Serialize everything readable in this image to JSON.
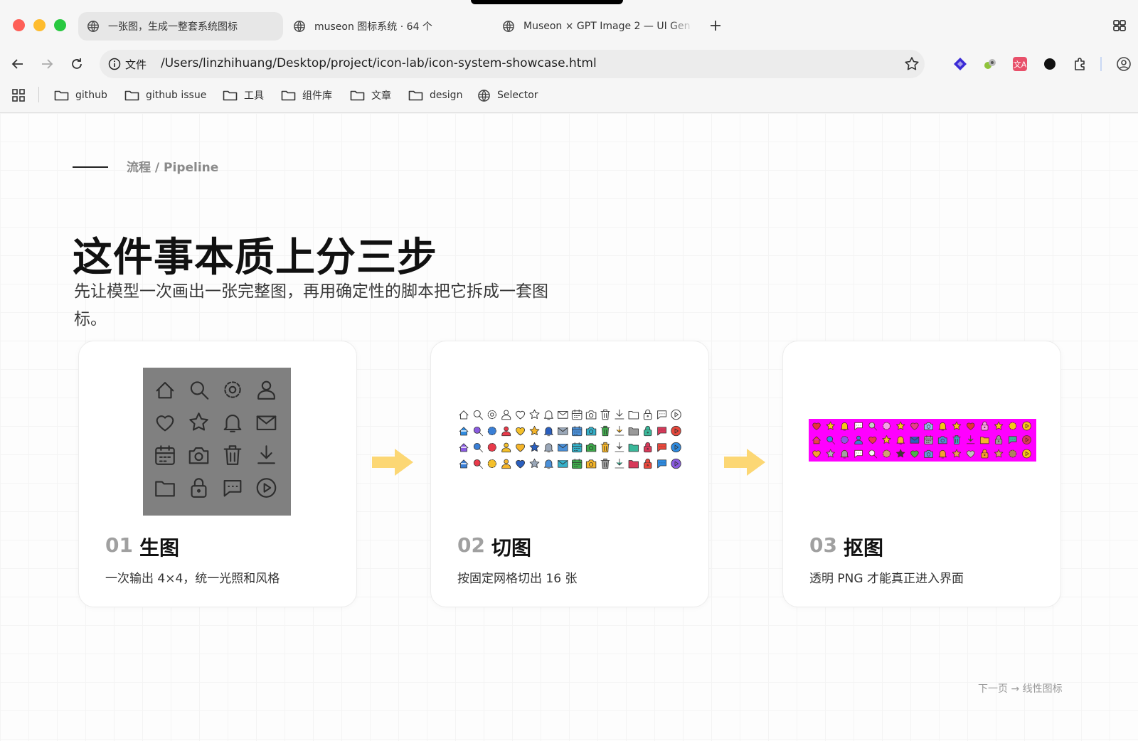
{
  "tabs": [
    {
      "title": "一张图，生成一整套系统图标",
      "active": true
    },
    {
      "title": "museon 图标系统 · 64 个",
      "active": false
    },
    {
      "title": "Museon × GPT Image 2 — UI Gen",
      "active": false
    }
  ],
  "address_bar": {
    "scheme": "文件",
    "url": "/Users/linzhihuang/Desktop/project/icon-lab/icon-system-showcase.html"
  },
  "bookmarks": [
    {
      "label": "github",
      "icon": "folder-icon"
    },
    {
      "label": "github issue",
      "icon": "folder-icon"
    },
    {
      "label": "工具",
      "icon": "folder-icon"
    },
    {
      "label": "组件库",
      "icon": "folder-icon"
    },
    {
      "label": "文章",
      "icon": "folder-icon"
    },
    {
      "label": "design",
      "icon": "folder-icon"
    },
    {
      "label": "Selector",
      "icon": "globe-icon"
    }
  ],
  "extensions": [
    "diamond-extension-icon",
    "puzzle-bot-extension-icon",
    "translate-extension-icon",
    "record-extension-icon",
    "extensions-puzzle-icon",
    "profile-icon"
  ],
  "page": {
    "eyebrow": "流程 / Pipeline",
    "title": "这件事本质上分三步",
    "subtitle": "先让模型一次画出一张完整图，再用确定性的脚本把它拆成一套图标。",
    "steps": [
      {
        "num": "01",
        "label": "生图",
        "desc": "一次输出 4×4，统一光照和风格"
      },
      {
        "num": "02",
        "label": "切图",
        "desc": "按固定网格切出 16 张"
      },
      {
        "num": "03",
        "label": "抠图",
        "desc": "透明 PNG 才能真正进入界面"
      }
    ],
    "footer": "下一页 → 线性图标"
  },
  "icon_grid_names": [
    "home-icon",
    "search-icon",
    "gear-icon",
    "user-icon",
    "heart-icon",
    "star-icon",
    "bell-icon",
    "mail-icon",
    "calendar-icon",
    "camera-icon",
    "trash-icon",
    "download-icon",
    "folder-icon",
    "lock-icon",
    "chat-icon",
    "play-icon"
  ],
  "colors": {
    "accent_arrow": "#fcd774",
    "magenta_bg": "#ff00ff",
    "icon_sheet_gray": "#808080"
  }
}
